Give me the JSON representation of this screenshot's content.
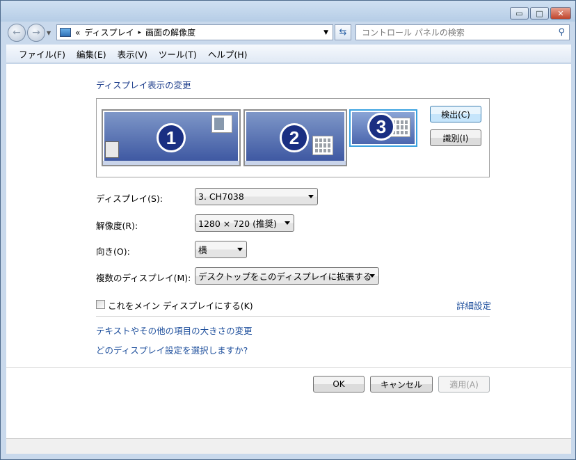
{
  "window": {
    "caption_buttons": {
      "minimize": "▭",
      "maximize": "□",
      "close": "✕"
    }
  },
  "addressbar": {
    "back_icon": "back-arrow-icon",
    "forward_icon": "forward-arrow-icon",
    "overflow": "«",
    "crumb1": "ディスプレイ",
    "separator": "▸",
    "crumb2": "画面の解像度",
    "dropdown": "▼",
    "refresh": "⇆",
    "search_placeholder": "コントロール パネルの検索",
    "search_icon": "⚲"
  },
  "menu": [
    "ファイル(F)",
    "編集(E)",
    "表示(V)",
    "ツール(T)",
    "ヘルプ(H)"
  ],
  "main": {
    "heading": "ディスプレイ表示の変更",
    "monitors": [
      "1",
      "2",
      "3"
    ],
    "detect_label": "検出(C)",
    "identify_label": "識別(I)",
    "display_label": "ディスプレイ(S):",
    "display_value": "3. CH7038",
    "resolution_label": "解像度(R):",
    "resolution_value": "1280 × 720 (推奨)",
    "orientation_label": "向き(O):",
    "orientation_value": "横",
    "multi_label": "複数のディスプレイ(M):",
    "multi_value": "デスクトップをこのディスプレイに拡張する",
    "main_display_check": "これをメイン ディスプレイにする(K)",
    "advanced_link": "詳細設定",
    "text_size_link": "テキストやその他の項目の大きさの変更",
    "which_settings_link": "どのディスプレイ設定を選択しますか?"
  },
  "footer": {
    "ok": "OK",
    "cancel": "キャンセル",
    "apply": "適用(A)"
  },
  "colors": {
    "link": "#1e4f9c",
    "heading": "#1e3e8c",
    "monitor_fill": "#3b55a0",
    "selected_border": "#3aa2e0"
  }
}
